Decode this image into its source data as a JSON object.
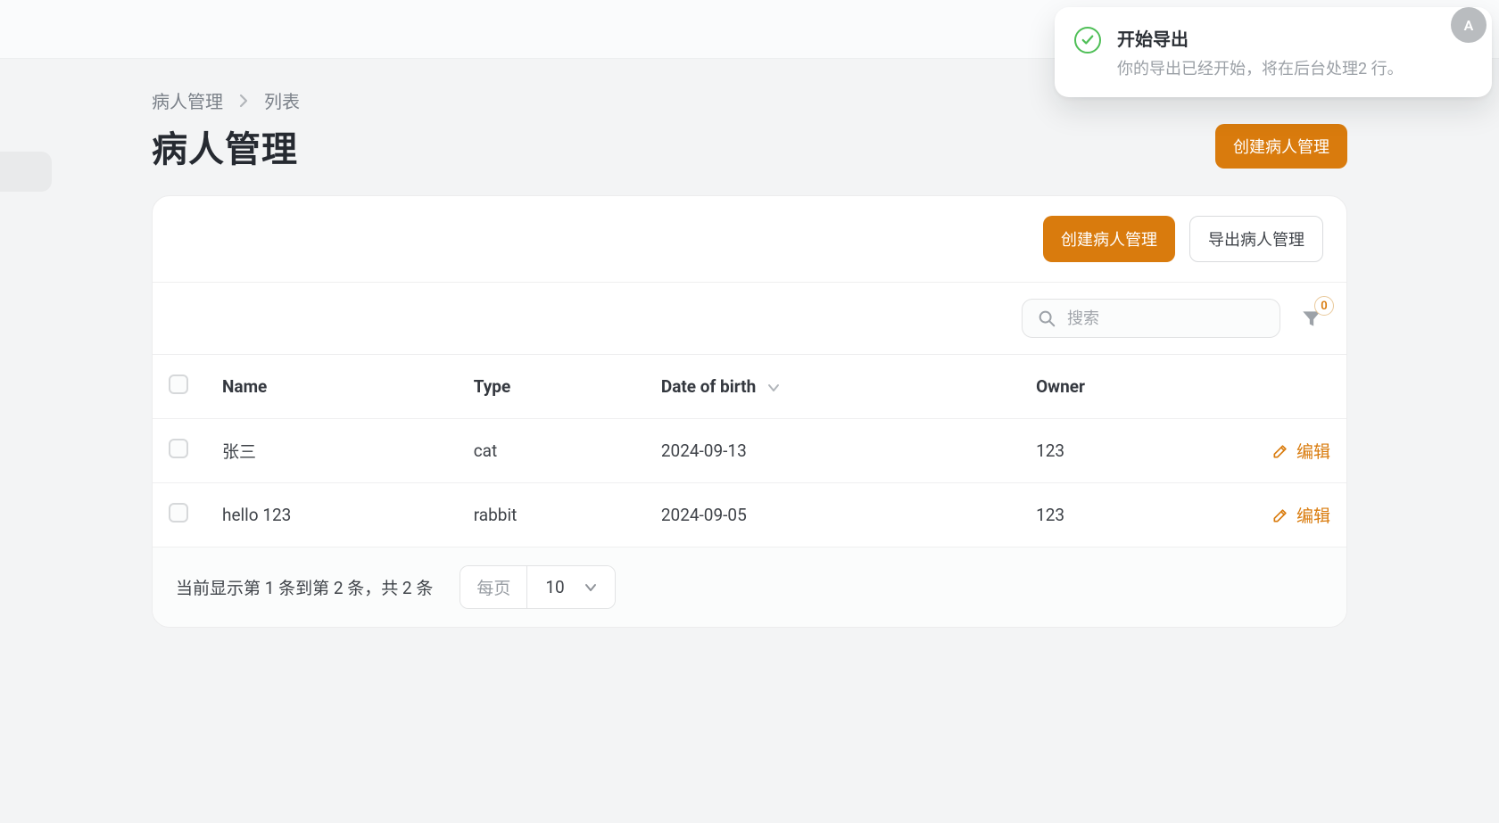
{
  "avatar": {
    "initial": "A"
  },
  "toast": {
    "title": "开始导出",
    "subtitle": "你的导出已经开始，将在后台处理2 行。"
  },
  "breadcrumbs": {
    "root": "病人管理",
    "current": "列表"
  },
  "page_title": "病人管理",
  "header_actions": {
    "create": "创建病人管理"
  },
  "panel_actions": {
    "create": "创建病人管理",
    "export": "导出病人管理"
  },
  "search": {
    "placeholder": "搜索"
  },
  "filter": {
    "badge": "0"
  },
  "table": {
    "columns": {
      "name": "Name",
      "type": "Type",
      "dob": "Date of birth",
      "owner": "Owner"
    },
    "row_action_label": "编辑",
    "rows": [
      {
        "name": "张三",
        "type": "cat",
        "dob": "2024-09-13",
        "owner": "123"
      },
      {
        "name": "hello 123",
        "type": "rabbit",
        "dob": "2024-09-05",
        "owner": "123"
      }
    ]
  },
  "footer": {
    "summary": "当前显示第 1 条到第 2 条，共 2 条",
    "per_page_label": "每页",
    "per_page_value": "10"
  }
}
